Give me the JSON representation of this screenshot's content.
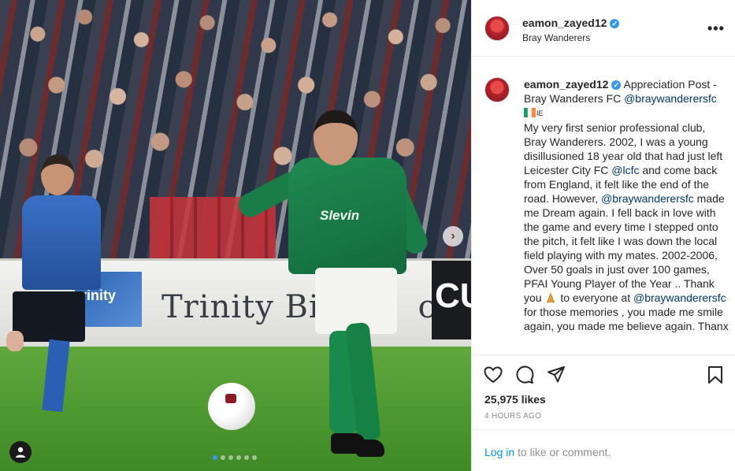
{
  "post": {
    "username": "eamon_zayed12",
    "verified": true,
    "location": "Bray Wanderers",
    "more_label": "•••",
    "carousel": {
      "slide_count": 6,
      "active_slide": 1
    }
  },
  "photo": {
    "hoarding_text": "Trinity Biote",
    "hoarding_text_end": "c",
    "hoarding_left_text": "rinity",
    "hoarding_right_text": "CU",
    "shirt_sponsor": "Slevin",
    "next_label": "›"
  },
  "caption": {
    "username": "eamon_zayed12",
    "parts": {
      "p1": " Appreciation Post - Bray Wanderers FC ",
      "m1": "@braywanderersfc",
      "p2": "IE",
      "p3": "My very first senior professional club, Bray Wanderers. 2002, I was a young disillusioned 18 year old that had just left Leicester City FC ",
      "m2": "@lcfc",
      "p4": " and come back from England, it felt like the end of the road. However, ",
      "m3": "@braywanderersfc",
      "p5": " made me Dream again. I fell back in love with the game and every time I stepped onto the pitch, it felt like I was down the local field playing with my mates. 2002-2006, Over 50 goals in just over 100 games, PFAI Young Player of the Year .. Thank you ",
      "p6": " to everyone at ",
      "m4": "@braywanderersfc",
      "p7": " for those memories , you made me smile again, you made me believe again. Thanx"
    }
  },
  "actions": {
    "likes": "25,975 likes",
    "time": "4 HOURS AGO",
    "login_link": "Log in",
    "login_rest": " to like or comment."
  },
  "colors": {
    "accent": "#0095f6",
    "mention": "#00376b",
    "verified": "#3897f0",
    "muted": "#8e8e8e"
  },
  "icons": [
    "heart-icon",
    "comment-icon",
    "share-icon",
    "bookmark-icon",
    "more-icon",
    "chevron-right-icon",
    "user-tag-icon",
    "verified-badge-icon"
  ]
}
